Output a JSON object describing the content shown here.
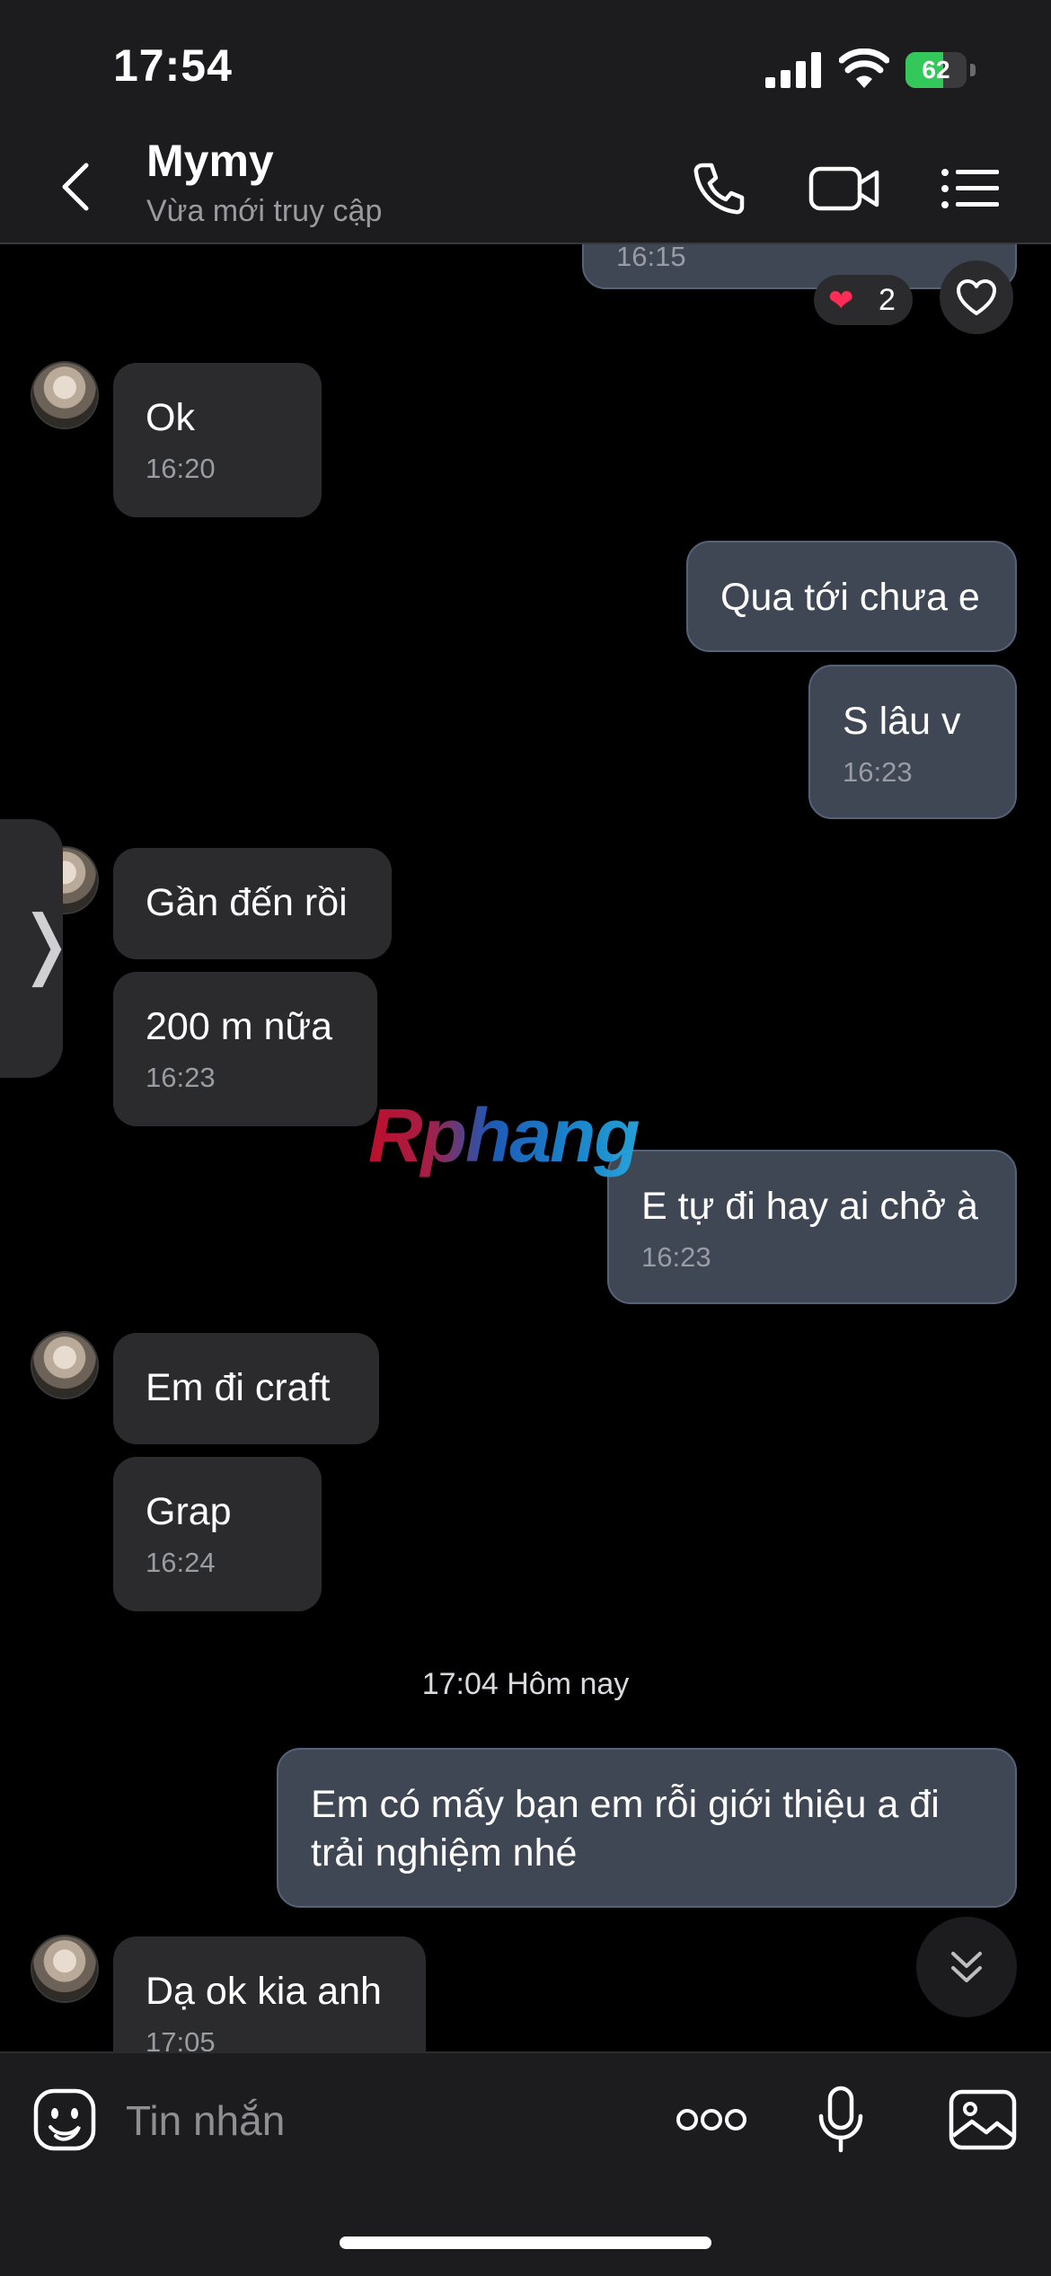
{
  "status_bar": {
    "time": "17:54",
    "battery": "62",
    "battery_level": 0.62
  },
  "header": {
    "name": "Mymy",
    "status": "Vừa mới truy cập"
  },
  "reaction": {
    "emoji": "❤",
    "count": "2"
  },
  "messages": [
    {
      "side": "out",
      "time": "16:15"
    },
    {
      "side": "in",
      "text": "Ok",
      "time": "16:20"
    },
    {
      "side": "out",
      "text": "Qua tới chưa e"
    },
    {
      "side": "out",
      "text": "S lâu v",
      "time": "16:23"
    },
    {
      "side": "in",
      "text": "Gần đến rồi"
    },
    {
      "side": "in",
      "text": "200 m nữa",
      "time": "16:23"
    },
    {
      "side": "out",
      "text": "E tự đi hay ai chở à",
      "time": "16:23"
    },
    {
      "side": "in",
      "text": "Em đi craft"
    },
    {
      "side": "in",
      "text": "Grap",
      "time": "16:24"
    },
    {
      "side": "out",
      "text": "Em có mấy bạn em rỗi giới thiệu a đi\ntrải nghiệm nhé"
    },
    {
      "side": "in",
      "text": "Dạ ok kia anh",
      "time": "17:05"
    }
  ],
  "day_separator": "17:04 Hôm nay",
  "watermark": "Rphang",
  "input": {
    "placeholder": "Tin nhắn"
  }
}
